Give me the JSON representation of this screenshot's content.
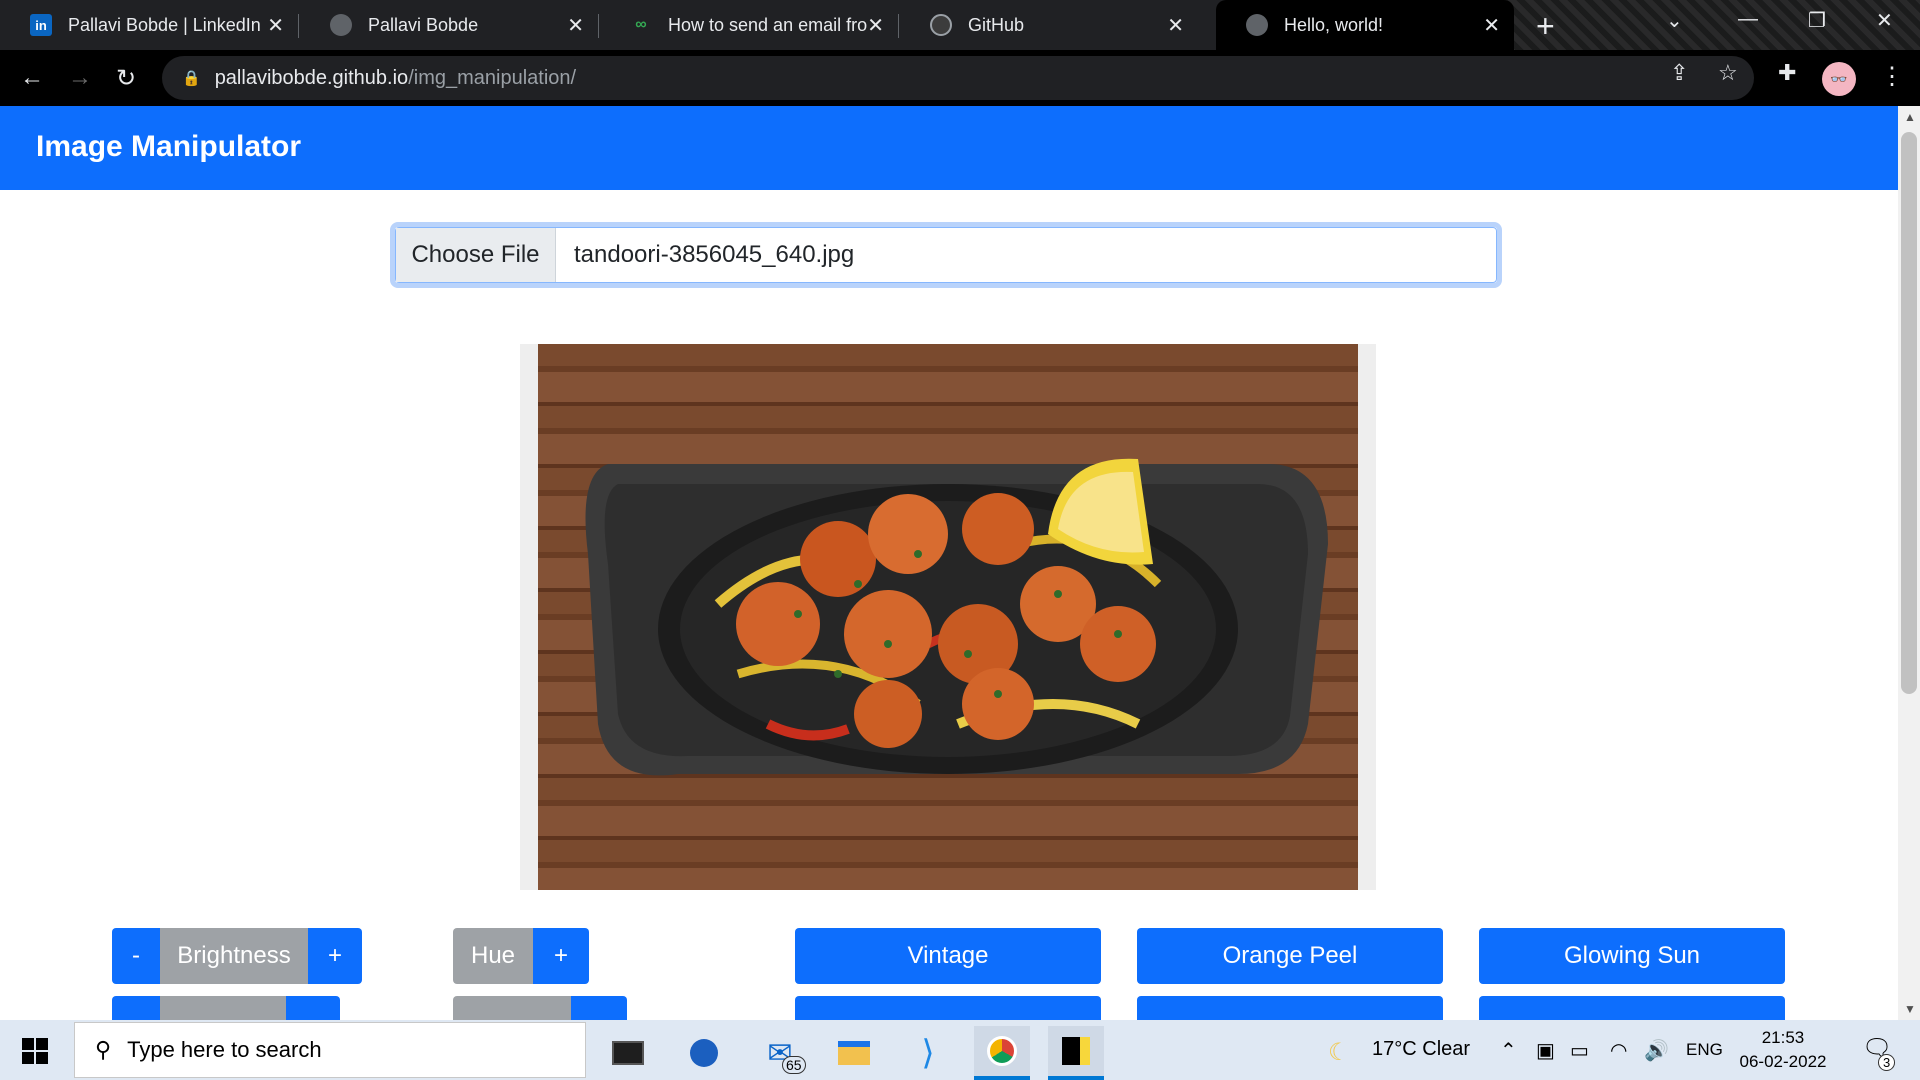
{
  "browser": {
    "tabs": [
      {
        "title": "Pallavi Bobde | LinkedIn",
        "favicon": "linkedin-icon"
      },
      {
        "title": "Pallavi Bobde",
        "favicon": "globe-icon"
      },
      {
        "title": "How to send an email fro",
        "favicon": "link-icon"
      },
      {
        "title": "GitHub",
        "favicon": "github-icon"
      },
      {
        "title": "Hello, world!",
        "favicon": "globe-icon"
      }
    ],
    "url_host": "pallavibobde.github.io",
    "url_path": "/img_manipulation/"
  },
  "page": {
    "brand": "Image Manipulator",
    "file_button": "Choose File",
    "file_name": "tandoori-3856045_640.jpg",
    "image_alt_icon": "tandoori-sizzler-image"
  },
  "controls": {
    "brightness": {
      "minus": "-",
      "label": "Brightness",
      "plus": "+"
    },
    "hue": {
      "label": "Hue",
      "plus": "+"
    },
    "filters": [
      "Vintage",
      "Orange Peel",
      "Glowing Sun"
    ]
  },
  "taskbar": {
    "search_placeholder": "Type here to search",
    "mail_badge": "65",
    "weather": "17°C  Clear",
    "lang": "ENG",
    "time": "21:53",
    "date": "06-02-2022",
    "notif_count": "3"
  },
  "colors": {
    "primary": "#0d6efd",
    "secondary": "#9ea2a6"
  }
}
